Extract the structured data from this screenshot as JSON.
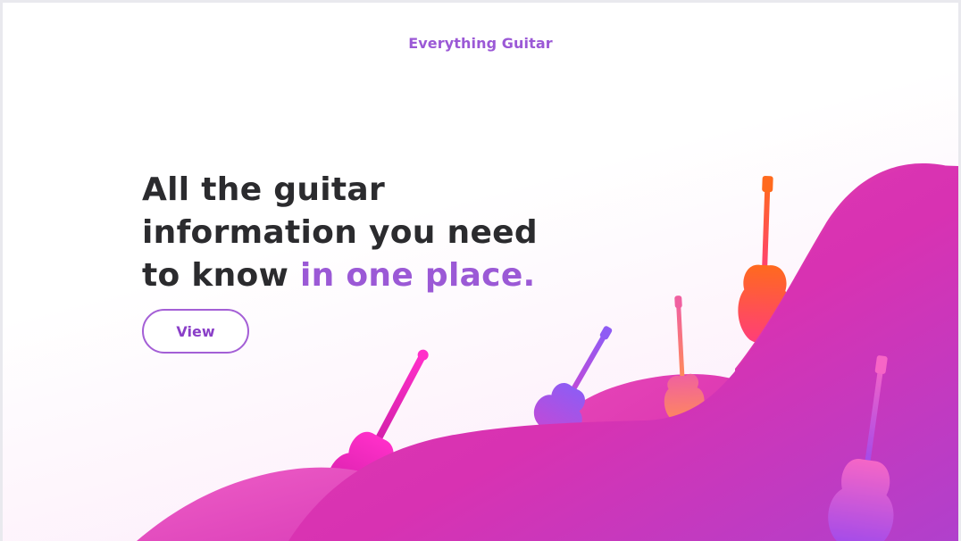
{
  "brand": {
    "name": "Everything Guitar",
    "color": "#9b59d6"
  },
  "hero": {
    "headline_line1": "All the guitar",
    "headline_line2": "information you need",
    "headline_line3_plain": "to know ",
    "headline_line3_accent": "in one place.",
    "accent_color": "#9b59d6",
    "view_button": "View"
  },
  "illustration": {
    "icons": [
      "guitar-icon"
    ],
    "colors": {
      "hill_magenta": "#d930b0",
      "hill_purple": "#b03ed0",
      "guitar_pink": "#f53ac0",
      "guitar_violet": "#9a5cf0",
      "guitar_salmon": "#ff7a70",
      "guitar_orange": "#ff6a2a"
    }
  }
}
